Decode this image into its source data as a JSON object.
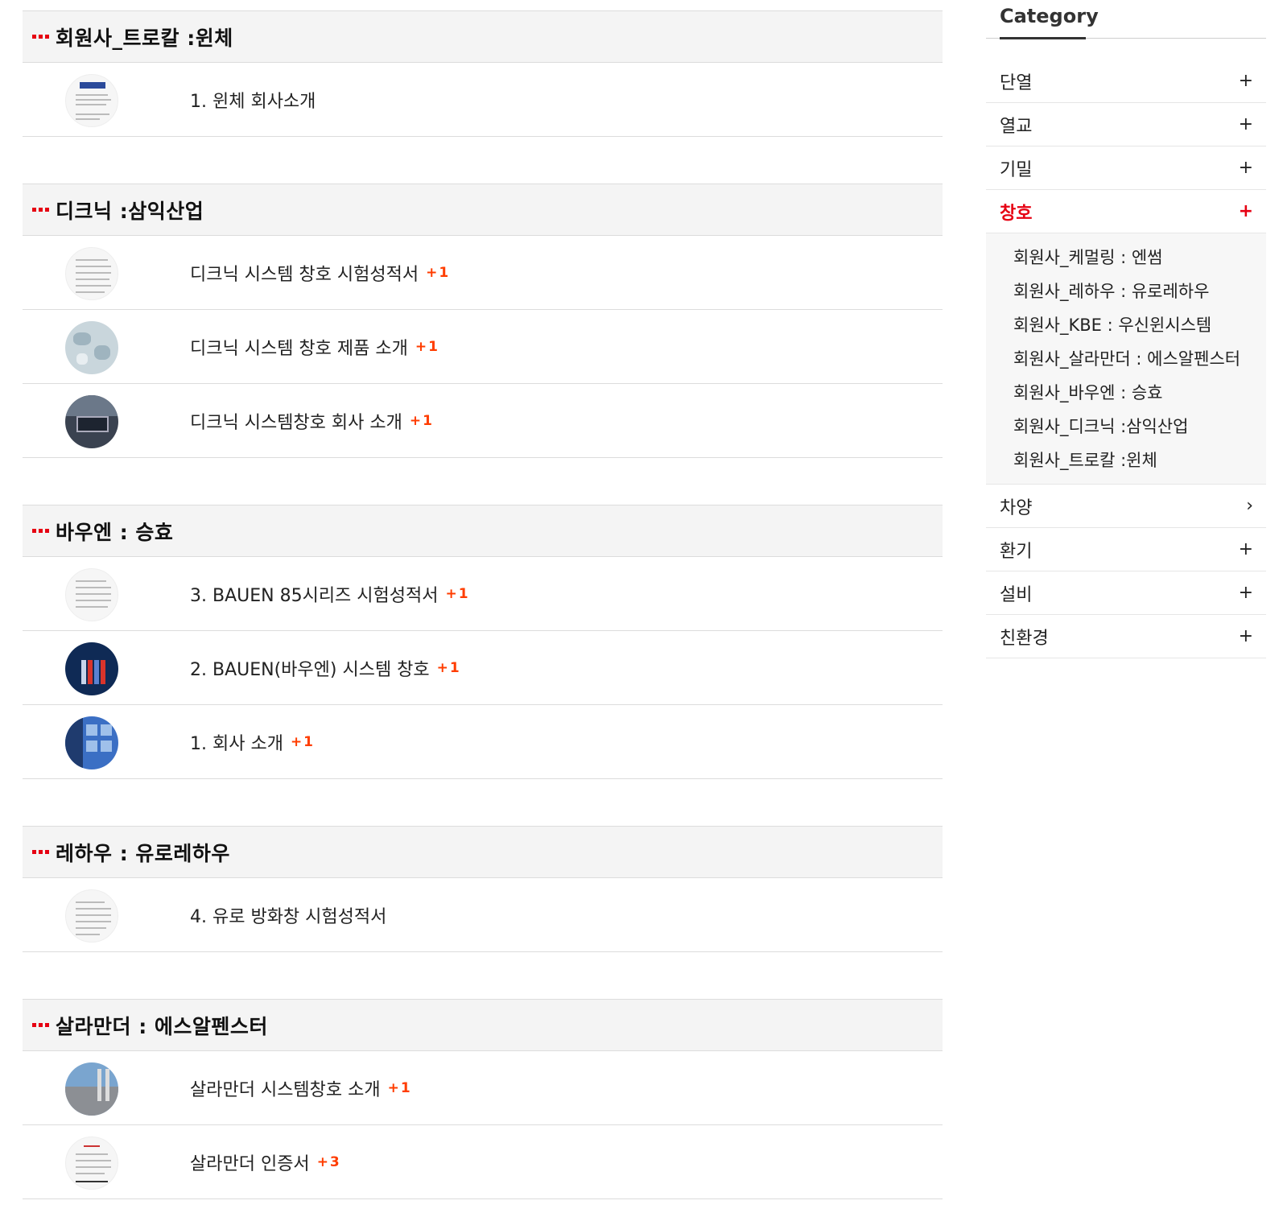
{
  "sections": [
    {
      "title": "회원사_트로칼 :윈체",
      "posts": [
        {
          "title": "1. 윈체 회사소개",
          "comments": ""
        }
      ]
    },
    {
      "title": "디크닉 :삼익산업",
      "posts": [
        {
          "title": "디크닉 시스템 창호 시험성적서",
          "comments": "+1"
        },
        {
          "title": "디크닉 시스템 창호 제품 소개",
          "comments": "+1"
        },
        {
          "title": "디크닉 시스템창호 회사 소개",
          "comments": "+1"
        }
      ]
    },
    {
      "title": "바우엔 : 승효",
      "posts": [
        {
          "title": "3. BAUEN 85시리즈 시험성적서",
          "comments": "+1"
        },
        {
          "title": "2. BAUEN(바우엔) 시스템 창호",
          "comments": "+1"
        },
        {
          "title": "1. 회사 소개",
          "comments": "+1"
        }
      ]
    },
    {
      "title": "레하우 : 유로레하우",
      "posts": [
        {
          "title": "4. 유로 방화창 시험성적서",
          "comments": ""
        }
      ]
    },
    {
      "title": "살라만더 : 에스알펜스터",
      "posts": [
        {
          "title": "살라만더 시스템창호 소개",
          "comments": "+1"
        },
        {
          "title": "살라만더 인증서",
          "comments": "+3"
        }
      ]
    }
  ],
  "sidebar": {
    "title": "Category",
    "items": [
      {
        "label": "단열",
        "sign": "+"
      },
      {
        "label": "열교",
        "sign": "+"
      },
      {
        "label": "기밀",
        "sign": "+"
      },
      {
        "label": "창호",
        "sign": "+"
      },
      {
        "label": "차양",
        "sign": "›"
      },
      {
        "label": "환기",
        "sign": "+"
      },
      {
        "label": "설비",
        "sign": "+"
      },
      {
        "label": "친환경",
        "sign": "+"
      }
    ],
    "active_index": 3,
    "sub_items": [
      "회원사_케멀링 : 엔썸",
      "회원사_레하우 : 유로레하우",
      "회원사_KBE : 우신윈시스템",
      "회원사_살라만더 : 에스알펜스터",
      "회원사_바우엔 : 승효",
      "회원사_디크닉 :삼익산업",
      "회원사_트로칼 :윈체"
    ]
  },
  "colors": {
    "accent": "#e60012",
    "comment": "#ff3d00"
  }
}
